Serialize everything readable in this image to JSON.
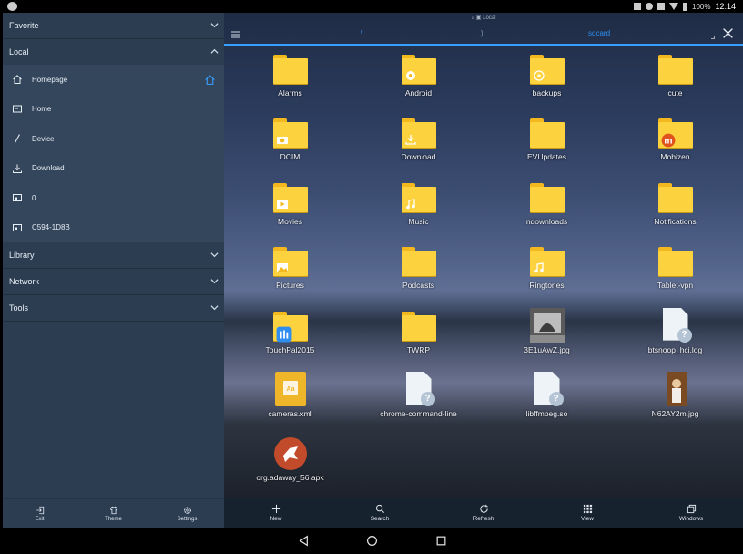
{
  "status_bar": {
    "battery": "100%",
    "time": "12:14"
  },
  "sidebar": {
    "groups": {
      "favorite": "Favorite",
      "local": "Local",
      "library": "Library",
      "network": "Network",
      "tools": "Tools"
    },
    "local_items": [
      {
        "label": "Homepage",
        "icon": "home-icon"
      },
      {
        "label": "Home",
        "icon": "desktop-icon"
      },
      {
        "label": "Device",
        "icon": "slash-icon"
      },
      {
        "label": "Download",
        "icon": "download-icon"
      },
      {
        "label": "0",
        "icon": "storage-icon"
      },
      {
        "label": "C594-1D8B",
        "icon": "sdcard-icon"
      }
    ],
    "bottom": {
      "exit": "Exit",
      "theme": "Theme",
      "settings": "Settings"
    }
  },
  "main": {
    "title": "Local",
    "breadcrumb": {
      "root": "/",
      "sep": ")",
      "current": "sdcard"
    },
    "files": [
      {
        "name": "Alarms",
        "kind": "folder"
      },
      {
        "name": "Android",
        "kind": "folder",
        "badge": "android-icon"
      },
      {
        "name": "backups",
        "kind": "folder",
        "badge": "backup-icon"
      },
      {
        "name": "cute",
        "kind": "folder"
      },
      {
        "name": "DCIM",
        "kind": "folder",
        "badge": "camera-icon"
      },
      {
        "name": "Download",
        "kind": "folder",
        "badge": "download-icon"
      },
      {
        "name": "EVUpdates",
        "kind": "folder"
      },
      {
        "name": "Mobizen",
        "kind": "folder",
        "badge": "mobizen-icon"
      },
      {
        "name": "Movies",
        "kind": "folder",
        "badge": "play-icon"
      },
      {
        "name": "Music",
        "kind": "folder",
        "badge": "music-icon"
      },
      {
        "name": "ndownloads",
        "kind": "folder"
      },
      {
        "name": "Notifications",
        "kind": "folder"
      },
      {
        "name": "Pictures",
        "kind": "folder",
        "badge": "picture-icon"
      },
      {
        "name": "Podcasts",
        "kind": "folder"
      },
      {
        "name": "Ringtones",
        "kind": "folder",
        "badge": "music-icon"
      },
      {
        "name": "Tablet-vpn",
        "kind": "folder"
      },
      {
        "name": "TouchPal2015",
        "kind": "folder",
        "badge": "touchpal-icon"
      },
      {
        "name": "TWRP",
        "kind": "folder"
      },
      {
        "name": "3E1uAwZ.jpg",
        "kind": "image"
      },
      {
        "name": "btsnoop_hci.log",
        "kind": "unknown"
      },
      {
        "name": "cameras.xml",
        "kind": "xml"
      },
      {
        "name": "chrome-command-line",
        "kind": "unknown"
      },
      {
        "name": "libffmpeg.so",
        "kind": "unknown"
      },
      {
        "name": "N62AY2m.jpg",
        "kind": "image2"
      },
      {
        "name": "org.adaway_56.apk",
        "kind": "apk"
      }
    ]
  },
  "bottom_bar": {
    "new": "New",
    "search": "Search",
    "refresh": "Refresh",
    "view": "View",
    "windows": "Windows"
  },
  "colors": {
    "accent": "#2e8ff0",
    "folder": "#fcd23e",
    "sidebar": "#2c3d52"
  }
}
